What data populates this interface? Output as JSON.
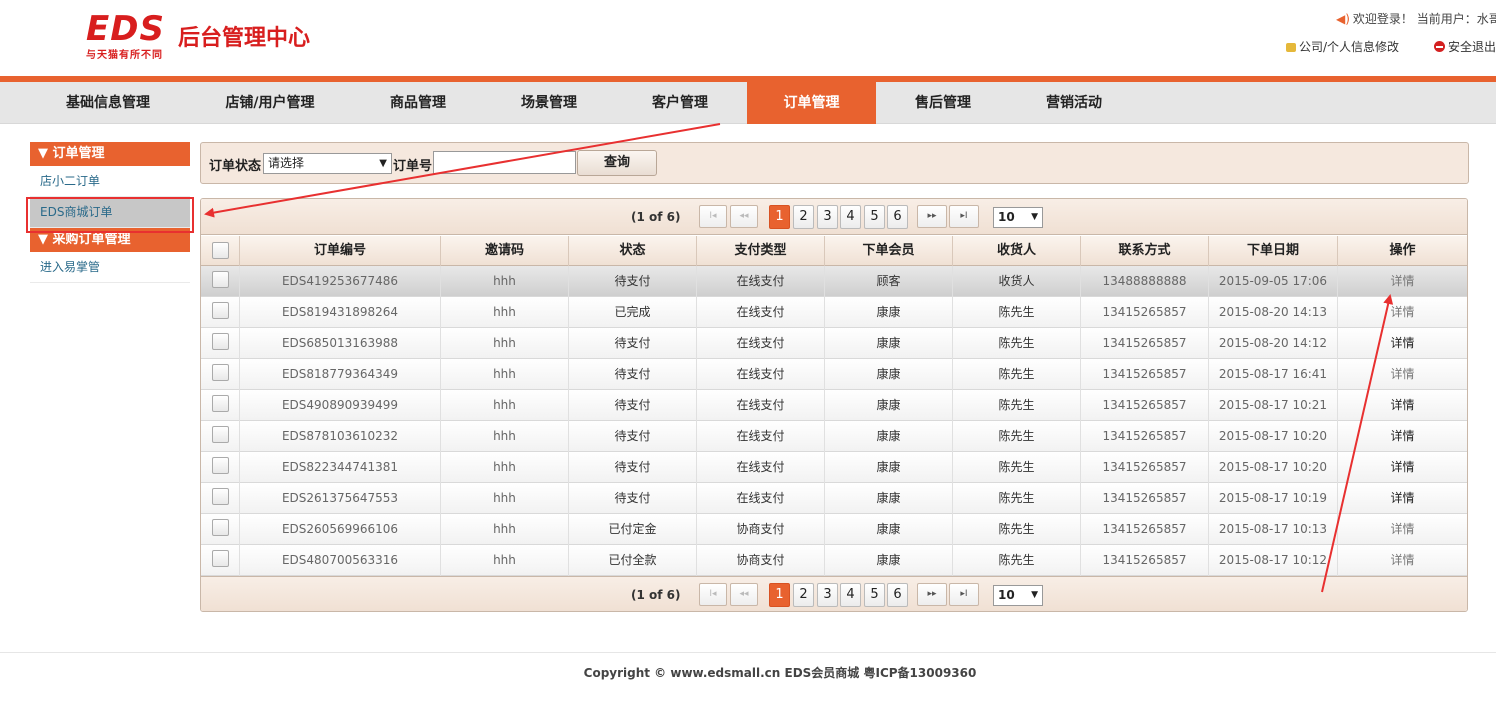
{
  "brand": {
    "logo_text": "EDS会员商城",
    "tagline": "与天猫有所不同",
    "system_name": "后台管理中心"
  },
  "header": {
    "welcome": "欢迎登录！ 当前用户：水哥",
    "company_link": "公司/个人信息修改",
    "logout_link": "安全退出"
  },
  "nav": {
    "items": [
      "基础信息管理",
      "店铺/用户管理",
      "商品管理",
      "场景管理",
      "客户管理",
      "订单管理",
      "售后管理",
      "营销活动"
    ],
    "active": "订单管理"
  },
  "sidebar": {
    "group1_title": "▼ 订单管理",
    "group1_items": [
      "店小二订单",
      "EDS商城订单"
    ],
    "group2_title": "▼ 采购订单管理",
    "group2_items": [
      "进入易掌管"
    ],
    "selected": "EDS商城订单"
  },
  "search": {
    "status_label": "订单状态",
    "status_value": "请选择",
    "order_no_label": "订单号",
    "order_no_value": "",
    "query_button": "查询"
  },
  "pager": {
    "info": "(1 of 6)",
    "first": "I◂",
    "prev": "◂◂",
    "next": "▸▸",
    "last": "▸I",
    "pages": [
      "1",
      "2",
      "3",
      "4",
      "5",
      "6"
    ],
    "current_page": "1",
    "page_size": "10"
  },
  "table": {
    "columns": [
      "订单编号",
      "邀请码",
      "状态",
      "支付类型",
      "下单会员",
      "收货人",
      "联系方式",
      "下单日期",
      "操作"
    ],
    "rows": [
      [
        "EDS419253677486",
        "hhh",
        "待支付",
        "在线支付",
        "顾客",
        "收货人",
        "13488888888",
        "2015-09-05 17:06",
        "详情"
      ],
      [
        "EDS819431898264",
        "hhh",
        "已完成",
        "在线支付",
        "康康",
        "陈先生",
        "13415265857",
        "2015-08-20 14:13",
        "详情"
      ],
      [
        "EDS685013163988",
        "hhh",
        "待支付",
        "在线支付",
        "康康",
        "陈先生",
        "13415265857",
        "2015-08-20 14:12",
        "详情"
      ],
      [
        "EDS818779364349",
        "hhh",
        "待支付",
        "在线支付",
        "康康",
        "陈先生",
        "13415265857",
        "2015-08-17 16:41",
        "详情"
      ],
      [
        "EDS490890939499",
        "hhh",
        "待支付",
        "在线支付",
        "康康",
        "陈先生",
        "13415265857",
        "2015-08-17 10:21",
        "详情"
      ],
      [
        "EDS878103610232",
        "hhh",
        "待支付",
        "在线支付",
        "康康",
        "陈先生",
        "13415265857",
        "2015-08-17 10:20",
        "详情"
      ],
      [
        "EDS822344741381",
        "hhh",
        "待支付",
        "在线支付",
        "康康",
        "陈先生",
        "13415265857",
        "2015-08-17 10:20",
        "详情"
      ],
      [
        "EDS261375647553",
        "hhh",
        "待支付",
        "在线支付",
        "康康",
        "陈先生",
        "13415265857",
        "2015-08-17 10:19",
        "详情"
      ],
      [
        "EDS260569966106",
        "hhh",
        "已付定金",
        "协商支付",
        "康康",
        "陈先生",
        "13415265857",
        "2015-08-17 10:13",
        "详情"
      ],
      [
        "EDS480700563316",
        "hhh",
        "已付全款",
        "协商支付",
        "康康",
        "陈先生",
        "13415265857",
        "2015-08-17 10:12",
        "详情"
      ]
    ]
  },
  "footer": {
    "copyright": "Copyright © www.edsmall.cn EDS会员商城 粤ICP备13009360"
  },
  "colors": {
    "accent": "#e8622f",
    "brand_red": "#d81e1e",
    "annotation_red": "#e83030"
  }
}
